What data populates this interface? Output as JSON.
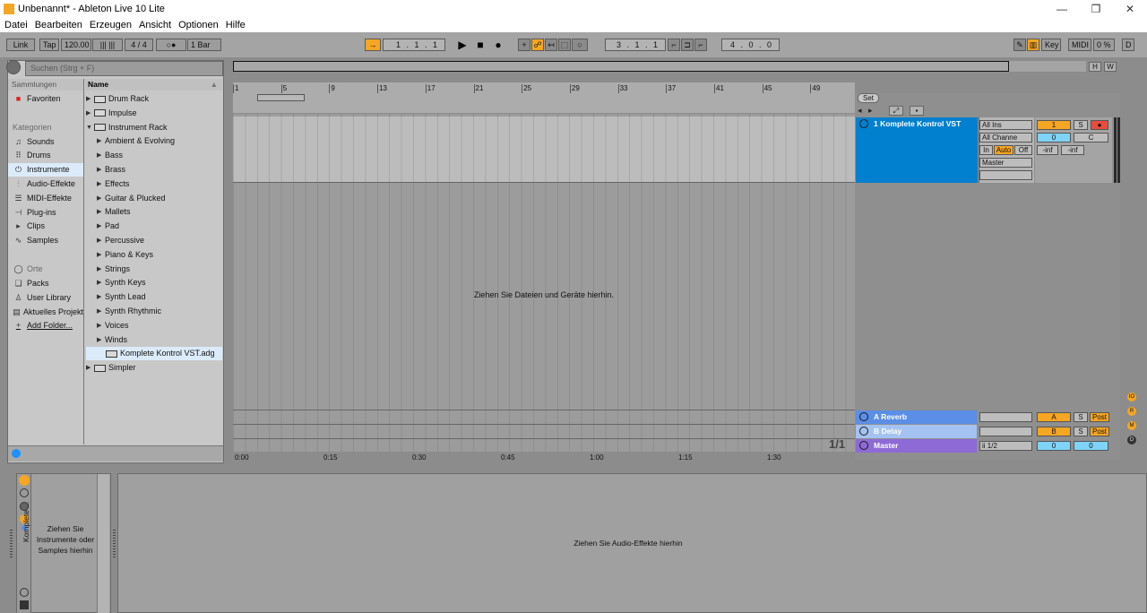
{
  "window": {
    "title": "Unbenannt* - Ableton Live 10 Lite",
    "controls": [
      "—",
      "❐",
      "✕"
    ]
  },
  "menu": [
    "Datei",
    "Bearbeiten",
    "Erzeugen",
    "Ansicht",
    "Optionen",
    "Hilfe"
  ],
  "control_bar": {
    "link": "Link",
    "tap": "Tap",
    "tempo": "120.00",
    "nudge": "|||  |||",
    "signature": "4 / 4",
    "metronome": "○●",
    "quantize": "1 Bar",
    "arrangement_position": "1 .  1 .  1",
    "loop_start": "3 .  1 .  1",
    "loop_length": "4 .  0 .  0",
    "key": "Key",
    "midi": "MIDI",
    "cpu": "0 %",
    "d": "D"
  },
  "browser": {
    "search_placeholder": "Suchen (Strg + F)",
    "collections_header": "Sammlungen",
    "name_header": "Name",
    "favorites": "Favoriten",
    "categories_header": "Kategorien",
    "categories": [
      {
        "label": "Sounds",
        "icon": "♫"
      },
      {
        "label": "Drums",
        "icon": "⠿"
      },
      {
        "label": "Instrumente",
        "icon": "⏻"
      },
      {
        "label": "Audio-Effekte",
        "icon": "⫶"
      },
      {
        "label": "MIDI-Effekte",
        "icon": "☰"
      },
      {
        "label": "Plug-ins",
        "icon": "⊣"
      },
      {
        "label": "Clips",
        "icon": "▸"
      },
      {
        "label": "Samples",
        "icon": "∿"
      }
    ],
    "places_header": "Orte",
    "places": [
      {
        "label": "Packs",
        "icon": "❏"
      },
      {
        "label": "User Library",
        "icon": "♙"
      },
      {
        "label": "Aktuelles Projekt",
        "icon": "▤"
      },
      {
        "label": "Add Folder...",
        "icon": "+"
      }
    ],
    "items": [
      {
        "label": "Drum Rack",
        "type": "folder",
        "tri": "▶"
      },
      {
        "label": "Impulse",
        "type": "folder",
        "tri": "▶"
      },
      {
        "label": "Instrument Rack",
        "type": "folder",
        "tri": "▼"
      },
      {
        "label": "Ambient & Evolving",
        "type": "sub",
        "tri": "▶"
      },
      {
        "label": "Bass",
        "type": "sub",
        "tri": "▶"
      },
      {
        "label": "Brass",
        "type": "sub",
        "tri": "▶"
      },
      {
        "label": "Effects",
        "type": "sub",
        "tri": "▶"
      },
      {
        "label": "Guitar & Plucked",
        "type": "sub",
        "tri": "▶"
      },
      {
        "label": "Mallets",
        "type": "sub",
        "tri": "▶"
      },
      {
        "label": "Pad",
        "type": "sub",
        "tri": "▶"
      },
      {
        "label": "Percussive",
        "type": "sub",
        "tri": "▶"
      },
      {
        "label": "Piano & Keys",
        "type": "sub",
        "tri": "▶"
      },
      {
        "label": "Strings",
        "type": "sub",
        "tri": "▶"
      },
      {
        "label": "Synth Keys",
        "type": "sub",
        "tri": "▶"
      },
      {
        "label": "Synth Lead",
        "type": "sub",
        "tri": "▶"
      },
      {
        "label": "Synth Rhythmic",
        "type": "sub",
        "tri": "▶"
      },
      {
        "label": "Voices",
        "type": "sub",
        "tri": "▶"
      },
      {
        "label": "Winds",
        "type": "sub",
        "tri": "▶"
      },
      {
        "label": "Komplete Kontrol VST.adg",
        "type": "file",
        "tri": ""
      },
      {
        "label": "Simpler",
        "type": "folder",
        "tri": "▶"
      }
    ]
  },
  "arrangement": {
    "bar_markers": [
      "1",
      "5",
      "9",
      "13",
      "17",
      "21",
      "25",
      "29",
      "33",
      "37",
      "41",
      "45",
      "49"
    ],
    "time_markers": [
      "0:00",
      "0:15",
      "0:30",
      "0:45",
      "1:00",
      "1:15",
      "1:30"
    ],
    "drop_hint": "Ziehen Sie Dateien und Geräte hierhin.",
    "pager": "1/1",
    "h_button": "H",
    "w_button": "W",
    "set_button": "Set"
  },
  "tracks": {
    "track1": {
      "name": "1 Komplete Kontrol VST",
      "input_type": "All Ins",
      "input_channel": "All Channe",
      "monitor": [
        "In",
        "Auto",
        "Off"
      ],
      "output": "Master",
      "track_number": "1",
      "solo": "S",
      "arm": "●",
      "volume": "0",
      "pan": "C",
      "meter_l": "-inf",
      "meter_r": "-inf"
    },
    "returns": [
      {
        "name": "A Reverb",
        "letter": "A",
        "solo": "S",
        "post": "Post"
      },
      {
        "name": "B Delay",
        "letter": "B",
        "solo": "S",
        "post": "Post"
      }
    ],
    "master": {
      "name": "Master",
      "output": "ii 1/2",
      "volume": "0",
      "pan": "0"
    }
  },
  "detail": {
    "device_hint": "Ziehen Sie Instrumente oder Samples hierhin",
    "device_title": "Komplete ...",
    "fx_hint": "Ziehen Sie Audio-Effekte hierhin"
  },
  "colors": {
    "track_blue": "#0080ce",
    "return_blue": "#5b8ee6",
    "master_purple": "#8e6ad6",
    "accent_orange": "#f5a623",
    "accent_cyan": "#7fd3f7"
  }
}
